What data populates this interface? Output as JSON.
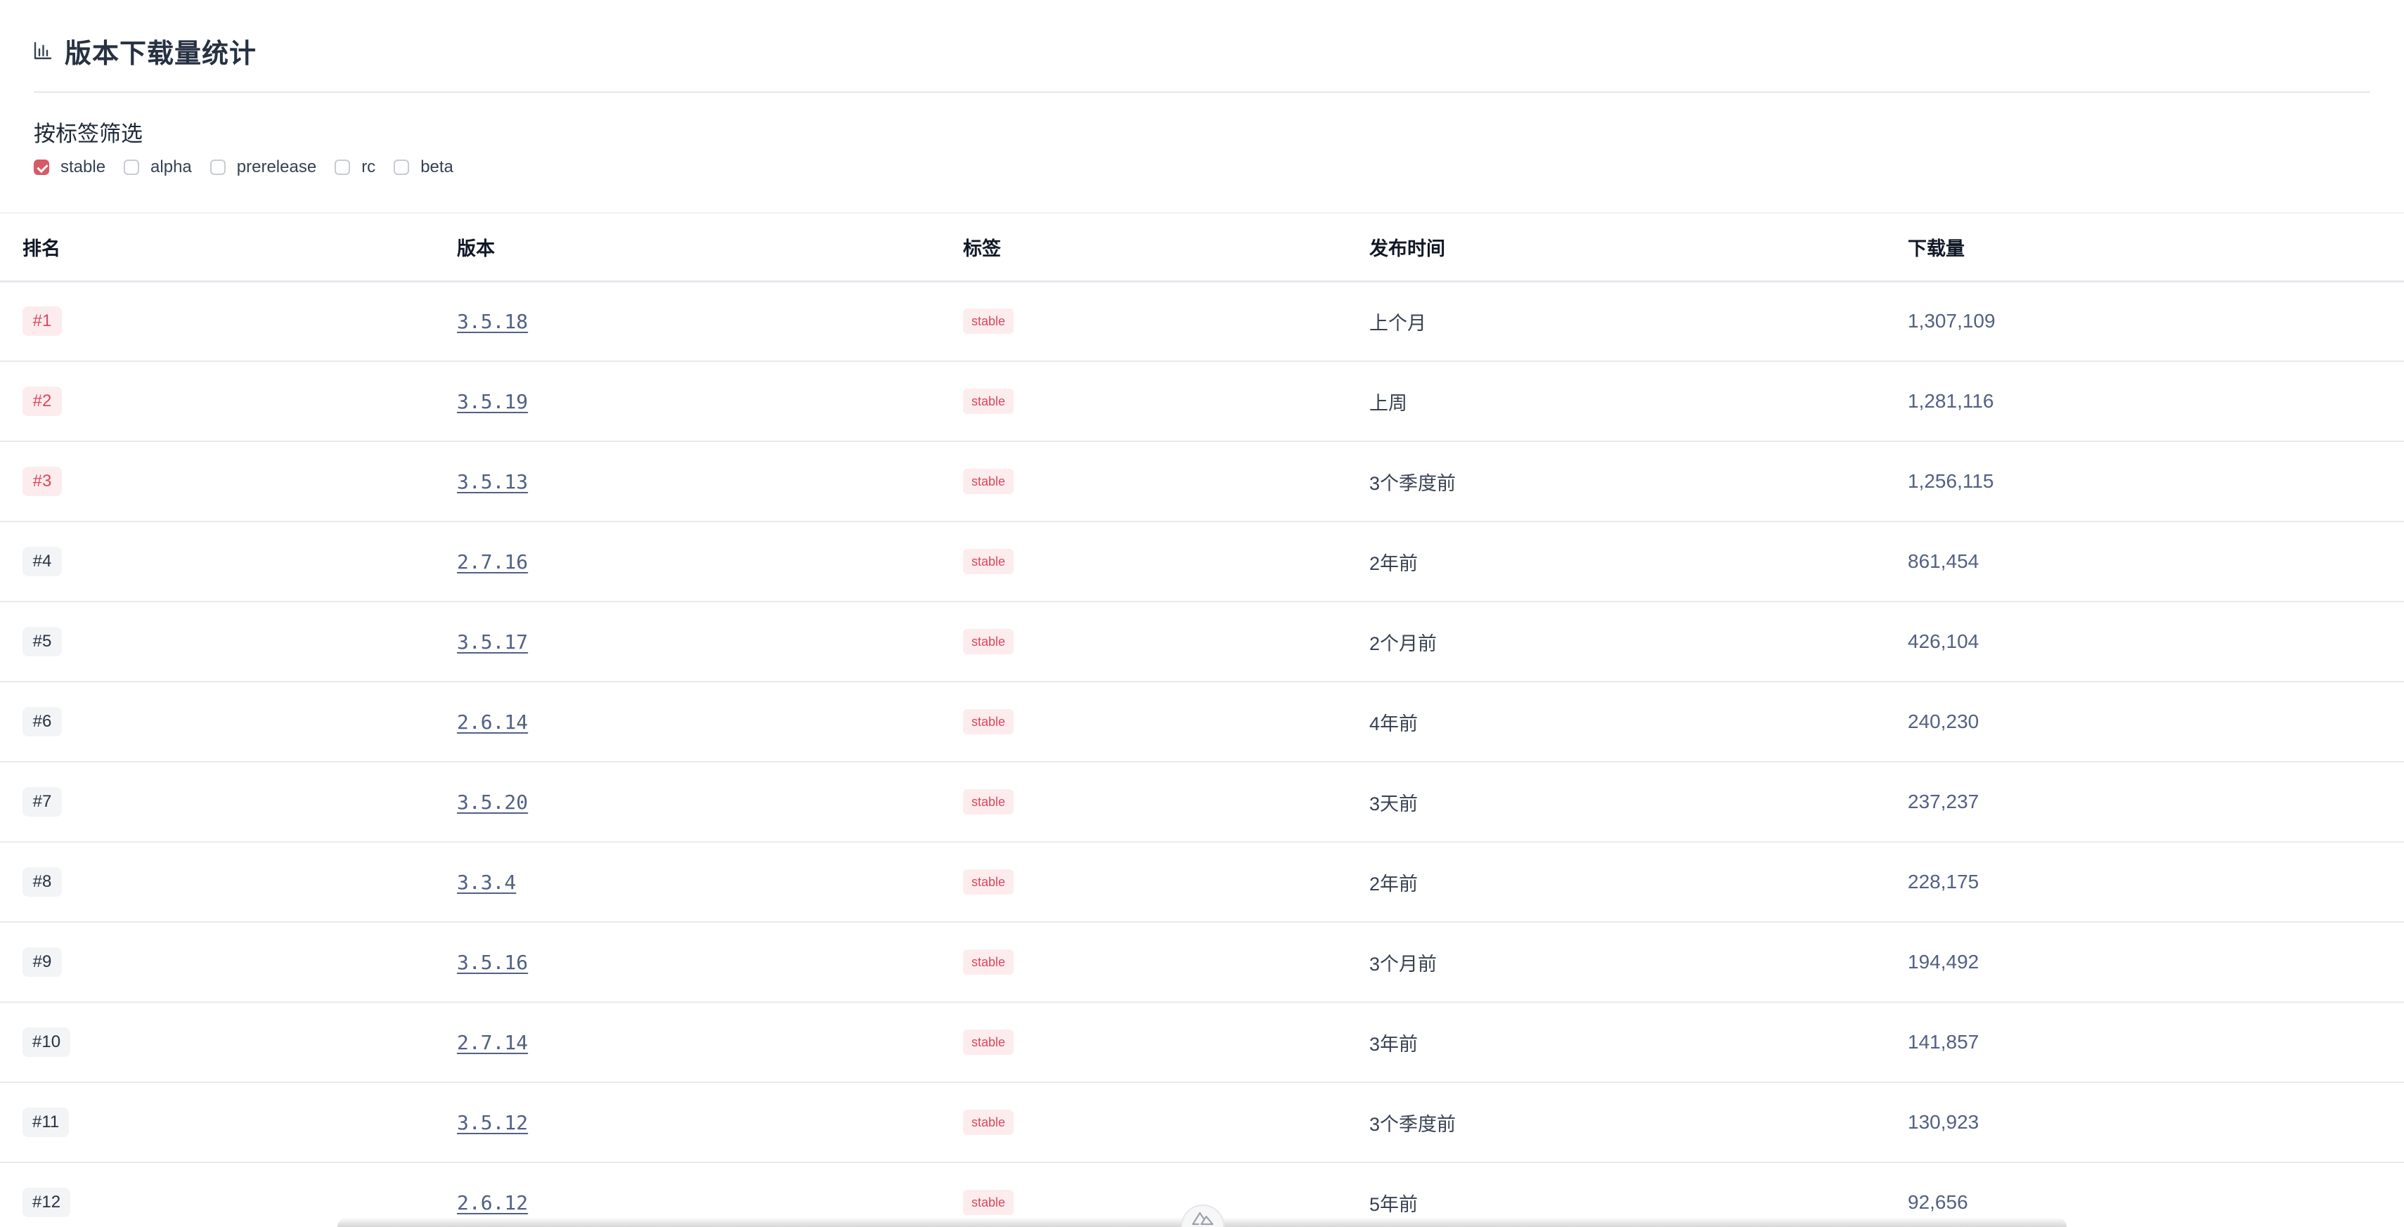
{
  "header": {
    "title": "版本下载量统计",
    "icon": "bar-chart-icon"
  },
  "filter": {
    "title": "按标签筛选",
    "options": [
      {
        "label": "stable",
        "checked": true
      },
      {
        "label": "alpha",
        "checked": false
      },
      {
        "label": "prerelease",
        "checked": false
      },
      {
        "label": "rc",
        "checked": false
      },
      {
        "label": "beta",
        "checked": false
      }
    ]
  },
  "table": {
    "headers": [
      "排名",
      "版本",
      "标签",
      "发布时间",
      "下载量"
    ],
    "rows": [
      {
        "rank": "#1",
        "version": "3.5.18",
        "tag": "stable",
        "time": "上个月",
        "downloads": "1,307,109"
      },
      {
        "rank": "#2",
        "version": "3.5.19",
        "tag": "stable",
        "time": "上周",
        "downloads": "1,281,116"
      },
      {
        "rank": "#3",
        "version": "3.5.13",
        "tag": "stable",
        "time": "3个季度前",
        "downloads": "1,256,115"
      },
      {
        "rank": "#4",
        "version": "2.7.16",
        "tag": "stable",
        "time": "2年前",
        "downloads": "861,454"
      },
      {
        "rank": "#5",
        "version": "3.5.17",
        "tag": "stable",
        "time": "2个月前",
        "downloads": "426,104"
      },
      {
        "rank": "#6",
        "version": "2.6.14",
        "tag": "stable",
        "time": "4年前",
        "downloads": "240,230"
      },
      {
        "rank": "#7",
        "version": "3.5.20",
        "tag": "stable",
        "time": "3天前",
        "downloads": "237,237"
      },
      {
        "rank": "#8",
        "version": "3.3.4",
        "tag": "stable",
        "time": "2年前",
        "downloads": "228,175"
      },
      {
        "rank": "#9",
        "version": "3.5.16",
        "tag": "stable",
        "time": "3个月前",
        "downloads": "194,492"
      },
      {
        "rank": "#10",
        "version": "2.7.14",
        "tag": "stable",
        "time": "3年前",
        "downloads": "141,857"
      },
      {
        "rank": "#11",
        "version": "3.5.12",
        "tag": "stable",
        "time": "3个季度前",
        "downloads": "130,923"
      },
      {
        "rank": "#12",
        "version": "2.6.12",
        "tag": "stable",
        "time": "5年前",
        "downloads": "92,656"
      }
    ]
  },
  "colors": {
    "accent": "#d85a67",
    "title": "#273142",
    "link": "#526082"
  },
  "floating_button": {
    "icon": "nuxt-logo-icon"
  }
}
